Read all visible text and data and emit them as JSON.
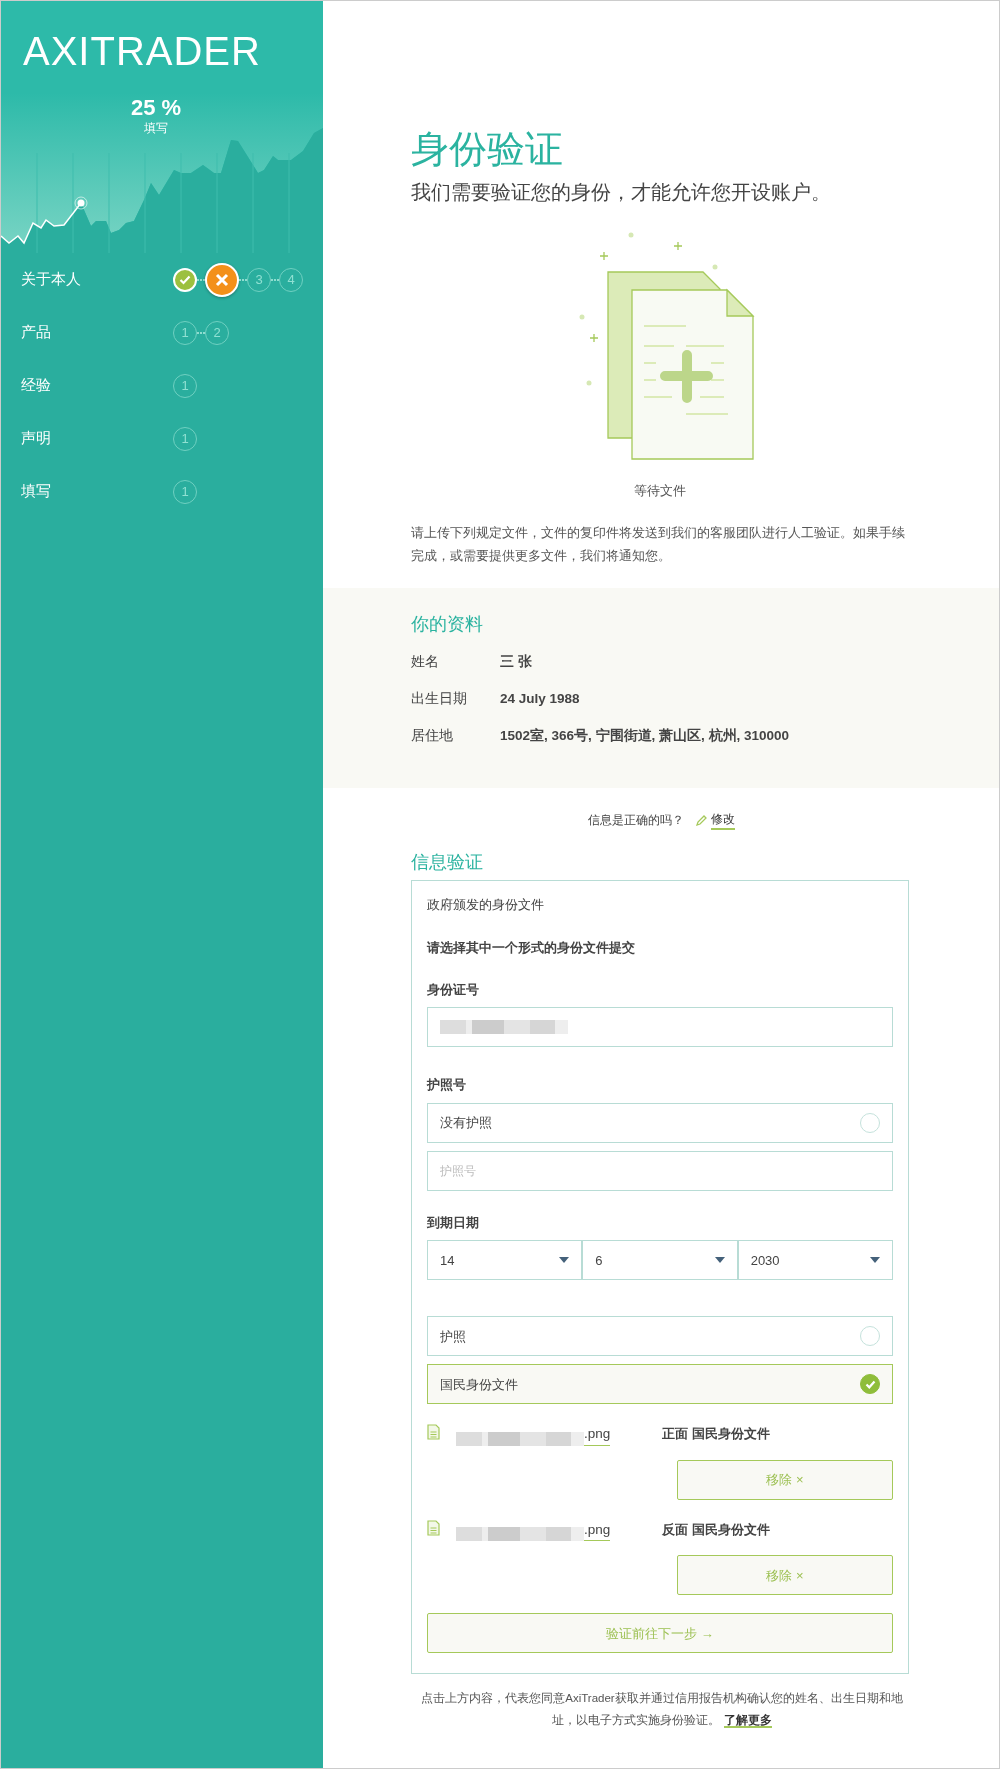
{
  "sidebar": {
    "logo": "AXITRADER",
    "progress": {
      "value": "25 %",
      "label": "填写"
    },
    "items": [
      {
        "label": "关于本人",
        "steps": [
          {
            "completed": true,
            "failed": false
          },
          {
            "completed": false,
            "failed": true
          },
          {
            "text": "3",
            "completed": false,
            "failed": false
          },
          {
            "text": "4",
            "completed": false,
            "failed": false
          }
        ]
      },
      {
        "label": "产品",
        "steps": [
          {
            "text": "1",
            "completed": false,
            "failed": false
          },
          {
            "text": "2",
            "completed": false,
            "failed": false
          }
        ]
      },
      {
        "label": "经验",
        "steps": [
          {
            "text": "1",
            "completed": false,
            "failed": false
          }
        ]
      },
      {
        "label": "声明",
        "steps": [
          {
            "text": "1",
            "completed": false,
            "failed": false
          }
        ]
      },
      {
        "label": "填写",
        "steps": [
          {
            "text": "1",
            "completed": false,
            "failed": false
          }
        ]
      }
    ]
  },
  "header": {
    "title": "身份验证",
    "subtitle": "我们需要验证您的身份，才能允许您开设账户。"
  },
  "illustration": {
    "caption": "等待文件"
  },
  "intro": "请上传下列规定文件，文件的复印件将发送到我们的客服团队进行人工验证。如果手续完成，或需要提供更多文件，我们将通知您。",
  "profile": {
    "title": "你的资料",
    "rows": [
      {
        "label": "姓名",
        "value": "三 张"
      },
      {
        "label": "出生日期",
        "value": "24 July 1988"
      },
      {
        "label": "居住地",
        "value": "1502室, 366号, 宁围街道, 萧山区, 杭州, 310000"
      }
    ],
    "confirm": "信息是正确的吗？",
    "edit": "修改"
  },
  "verification": {
    "title": "信息验证",
    "box_title": "政府颁发的身份文件",
    "instruction": "请选择其中一个形式的身份文件提交",
    "id_number": {
      "label": "身份证号",
      "redacted": true
    },
    "passport": {
      "label": "护照号",
      "no_passport": {
        "label": "没有护照",
        "checked": false
      },
      "placeholder": "护照号"
    },
    "expiry": {
      "label": "到期日期",
      "selects": [
        "14",
        "6",
        "2030"
      ]
    },
    "doc_types": [
      {
        "label": "护照",
        "selected": false
      },
      {
        "label": "国民身份文件",
        "selected": true
      }
    ],
    "files": [
      {
        "name": ".png",
        "label": "正面 国民身份文件",
        "button": "移除 ×"
      },
      {
        "name": ".png",
        "label": "反面 国民身份文件",
        "button": "移除 ×"
      }
    ],
    "submit": "验证前往下一步 →"
  },
  "footer": {
    "text": "点击上方内容，代表您同意AxiTrader获取并通过信用报告机构确认您的姓名、出生日期和地址，以电子方式实施身份验证。",
    "link": "了解更多"
  }
}
